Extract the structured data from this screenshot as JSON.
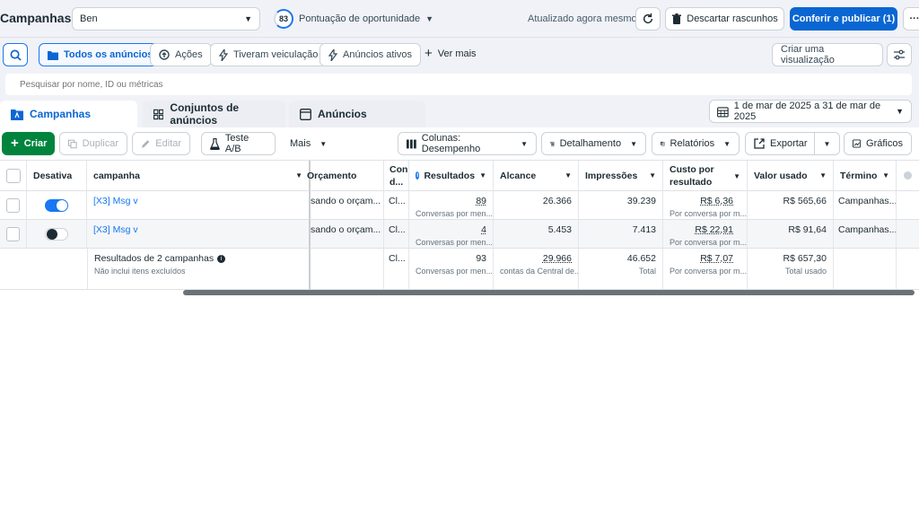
{
  "header": {
    "title": "Campanhas",
    "account_select": "Ben",
    "opportunity_score": "83",
    "opportunity_label": "Pontuação de oportunidade",
    "updated_text": "Atualizado agora mesmo",
    "discard_label": "Descartar rascunhos",
    "publish_label": "Conferir e publicar (1)"
  },
  "filters": {
    "all_ads": "Todos os anúncios",
    "actions": "Ações",
    "had_delivery": "Tiveram veiculação",
    "active_ads": "Anúncios ativos",
    "see_more": "Ver mais",
    "create_view": "Criar uma visualização"
  },
  "search": {
    "placeholder": "Pesquisar por nome, ID ou métricas"
  },
  "tabs": {
    "campaigns": "Campanhas",
    "ad_sets": "Conjuntos de anúncios",
    "ads": "Anúncios",
    "date_range": "1 de mar de 2025 a 31 de mar de 2025"
  },
  "toolbar": {
    "create": "Criar",
    "duplicate": "Duplicar",
    "edit": "Editar",
    "ab_test": "Teste A/B",
    "more": "Mais",
    "columns": "Colunas: Desempenho",
    "breakdown": "Detalhamento",
    "reports": "Relatórios",
    "export": "Exportar",
    "charts": "Gráficos"
  },
  "table": {
    "headers": {
      "toggle": "Desativa",
      "campaign": "campanha",
      "budget": "Orçamento",
      "config_line1": "Con",
      "config_line2": "d...",
      "results": "Resultados",
      "reach": "Alcance",
      "impressions": "Impressões",
      "cost_line1": "Custo por",
      "cost_line2": "resultado",
      "amount_spent": "Valor usado",
      "end": "Término"
    },
    "rows": [
      {
        "name": "[X3] Msg v",
        "budget": "sando o orçam...",
        "config": "Cl...",
        "results": "89",
        "results_sub": "Conversas por men...",
        "reach": "26.366",
        "impressions": "39.239",
        "cost": "R$ 6,36",
        "cost_sub": "Por conversa por m...",
        "spent": "R$ 565,66",
        "end": "Campanhas..."
      },
      {
        "name": "[X3] Msg v",
        "budget": "sando o orçam...",
        "config": "Cl...",
        "results": "4",
        "results_sub": "Conversas por men...",
        "reach": "5.453",
        "impressions": "7.413",
        "cost": "R$ 22,91",
        "cost_sub": "Por conversa por m...",
        "spent": "R$ 91,64",
        "end": "Campanhas..."
      }
    ],
    "summary": {
      "title": "Resultados de 2 campanhas",
      "note": "Não inclui itens excluídos",
      "config": "Cl...",
      "results": "93",
      "results_sub": "Conversas por men...",
      "reach": "29.966",
      "reach_sub": "contas da Central de...",
      "impressions": "46.652",
      "impressions_sub": "Total",
      "cost": "R$ 7,07",
      "cost_sub": "Por conversa por m...",
      "spent": "R$ 657,30",
      "spent_sub": "Total usado"
    }
  },
  "colors": {
    "accent": "#1877f2",
    "primary_button": "#0a66d2",
    "create_button": "#00843d"
  }
}
